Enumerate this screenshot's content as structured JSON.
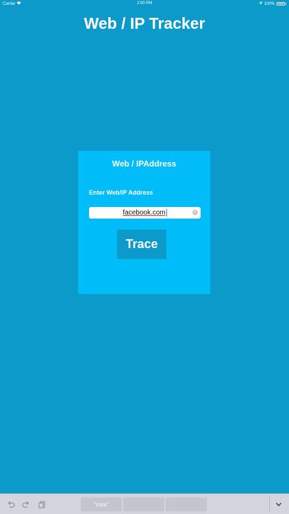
{
  "status_bar": {
    "carrier": "Carrier",
    "time": "2:00 PM",
    "battery": "100%"
  },
  "app": {
    "title": "Web / IP Tracker"
  },
  "card": {
    "title": "Web / IPAddress",
    "field_label": "Enter Web/IP Address",
    "input_value": "facebook.com",
    "button_label": "Trace"
  },
  "keyboard": {
    "suggestions": [
      "\"com\"",
      "",
      ""
    ]
  },
  "colors": {
    "background": "#0b9ac9",
    "card": "#00bdf9",
    "button": "#0b9ac9",
    "text": "#ffffff"
  }
}
